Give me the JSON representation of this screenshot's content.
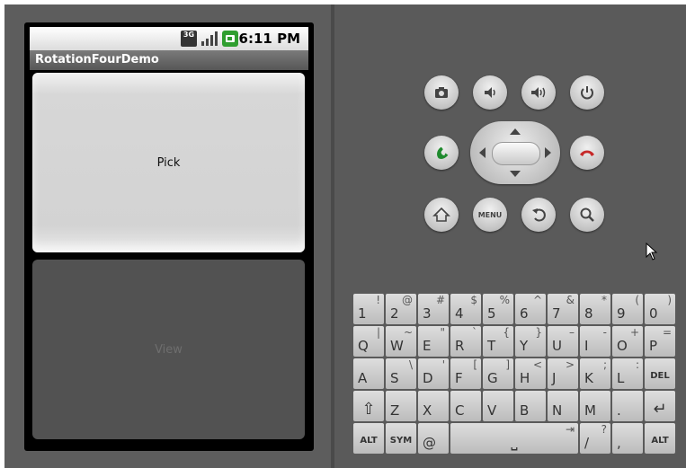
{
  "status_bar": {
    "network": "3G",
    "time": "6:11 PM"
  },
  "app": {
    "title": "RotationFourDemo",
    "pick_label": "Pick",
    "view_label": "View"
  },
  "hardware_buttons": {
    "camera": "camera-icon",
    "volume_down": "volume-down-icon",
    "volume_up": "volume-up-icon",
    "power": "power-icon",
    "call": "call-icon",
    "end_call": "end-call-icon",
    "home": "home-icon",
    "menu_label": "MENU",
    "back": "back-icon",
    "search": "search-icon"
  },
  "keyboard": {
    "rows": [
      [
        {
          "k": "1",
          "a": "!"
        },
        {
          "k": "2",
          "a": "@"
        },
        {
          "k": "3",
          "a": "#"
        },
        {
          "k": "4",
          "a": "$"
        },
        {
          "k": "5",
          "a": "%"
        },
        {
          "k": "6",
          "a": "^"
        },
        {
          "k": "7",
          "a": "&"
        },
        {
          "k": "8",
          "a": "*"
        },
        {
          "k": "9",
          "a": "("
        },
        {
          "k": "0",
          "a": ")"
        }
      ],
      [
        {
          "k": "Q",
          "a": "|"
        },
        {
          "k": "W",
          "a": "~"
        },
        {
          "k": "E",
          "a": "\""
        },
        {
          "k": "R",
          "a": "`"
        },
        {
          "k": "T",
          "a": "{"
        },
        {
          "k": "Y",
          "a": "}"
        },
        {
          "k": "U",
          "a": "–"
        },
        {
          "k": "I",
          "a": "-"
        },
        {
          "k": "O",
          "a": "+"
        },
        {
          "k": "P",
          "a": "="
        }
      ],
      [
        {
          "k": "A",
          "a": ""
        },
        {
          "k": "S",
          "a": "\\"
        },
        {
          "k": "D",
          "a": "'"
        },
        {
          "k": "F",
          "a": "["
        },
        {
          "k": "G",
          "a": "]"
        },
        {
          "k": "H",
          "a": "<"
        },
        {
          "k": "J",
          "a": ">"
        },
        {
          "k": "K",
          "a": ";"
        },
        {
          "k": "L",
          "a": ":"
        },
        {
          "k": "DEL",
          "a": ""
        }
      ],
      [
        {
          "k": "⇧",
          "a": ""
        },
        {
          "k": "Z",
          "a": ""
        },
        {
          "k": "X",
          "a": ""
        },
        {
          "k": "C",
          "a": ""
        },
        {
          "k": "V",
          "a": ""
        },
        {
          "k": "B",
          "a": ""
        },
        {
          "k": "N",
          "a": ""
        },
        {
          "k": "M",
          "a": ""
        },
        {
          "k": ".",
          "a": ""
        },
        {
          "k": "↵",
          "a": ""
        }
      ],
      [
        {
          "k": "ALT",
          "a": ""
        },
        {
          "k": "SYM",
          "a": ""
        },
        {
          "k": "@",
          "a": ""
        },
        {
          "k": "⎵",
          "a": "⇥"
        },
        {
          "k": "/",
          "a": "?"
        },
        {
          "k": ",",
          "a": ""
        },
        {
          "k": "ALT",
          "a": ""
        }
      ]
    ]
  },
  "colors": {
    "skin": "#5d5d5d",
    "call_green": "#1f8a2e",
    "end_red": "#c62828"
  }
}
